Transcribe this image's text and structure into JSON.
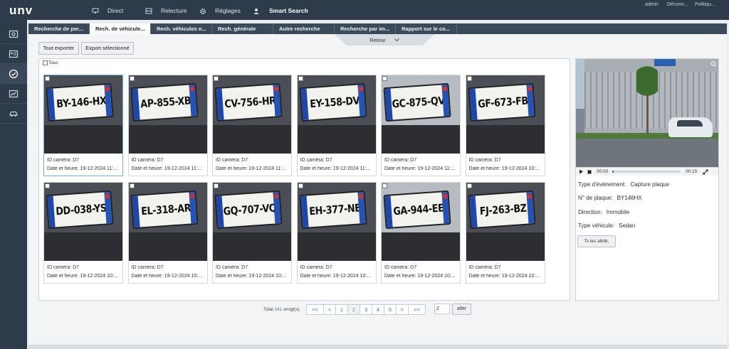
{
  "brand": {
    "logo": "unv"
  },
  "top_nav": {
    "items": [
      {
        "label": "Direct",
        "icon": "monitor-icon"
      },
      {
        "label": "Relecture",
        "icon": "film-icon"
      },
      {
        "label": "Réglages",
        "icon": "gear-icon"
      },
      {
        "label": "Smart Search",
        "icon": "person-search-icon",
        "active": true
      }
    ],
    "right_links": [
      "admin",
      "Déconn...",
      "Politiqu..."
    ]
  },
  "sidebar": {
    "items": [
      {
        "icon": "image-search-icon"
      },
      {
        "icon": "id-card-icon"
      },
      {
        "icon": "gauge-icon",
        "active": true
      },
      {
        "icon": "chart-icon"
      },
      {
        "icon": "car-icon"
      }
    ]
  },
  "tabs": [
    {
      "label": "Recherche de per..."
    },
    {
      "label": "Rech. de véhicule...",
      "active": true
    },
    {
      "label": "Rech. véhicules n..."
    },
    {
      "label": "Rech. générale"
    },
    {
      "label": "Autre recherche"
    },
    {
      "label": "Recherche par im..."
    },
    {
      "label": "Rapport sur le co..."
    }
  ],
  "retour": {
    "label": "Retour"
  },
  "toolbar": {
    "export_all": "Tout exporter",
    "export_selected": "Export sélectionné"
  },
  "select_all": {
    "label": "Tous"
  },
  "results": [
    {
      "plate": "BY-146-HX",
      "camera": "ID caméra: D7",
      "datetime": "Date et heure: 19-12-2024 11:...",
      "selected": true
    },
    {
      "plate": "AP-855-XB",
      "camera": "ID caméra: D7",
      "datetime": "Date et heure: 19-12-2024 11:..."
    },
    {
      "plate": "CV-756-HR",
      "camera": "ID caméra: D7",
      "datetime": "Date et heure: 19-12-2024 11:..."
    },
    {
      "plate": "EY-158-DV",
      "camera": "ID caméra: D7",
      "datetime": "Date et heure: 19-12-2024 11:..."
    },
    {
      "plate": "GC-875-QV",
      "camera": "ID caméra: D7",
      "datetime": "Date et heure: 19-12-2024 11:..."
    },
    {
      "plate": "GF-673-FB",
      "camera": "ID caméra: D7",
      "datetime": "Date et heure: 19-12-2024 10:..."
    },
    {
      "plate": "DD-038-YS",
      "camera": "ID caméra: D7",
      "datetime": "Date et heure: 19-12-2024 10:..."
    },
    {
      "plate": "EL-318-AR",
      "camera": "ID caméra: D7",
      "datetime": "Date et heure: 19-12-2024 10:..."
    },
    {
      "plate": "GQ-707-VQ",
      "camera": "ID caméra: D7",
      "datetime": "Date et heure: 19-12-2024 10:..."
    },
    {
      "plate": "EH-377-NE",
      "camera": "ID caméra: D7",
      "datetime": "Date et heure: 19-12-2024 10:..."
    },
    {
      "plate": "GA-944-EE",
      "camera": "ID caméra: D7",
      "datetime": "Date et heure: 19-12-2024 10:..."
    },
    {
      "plate": "FJ-263-BZ",
      "camera": "ID caméra: D7",
      "datetime": "Date et heure: 19-12-2024 10:..."
    }
  ],
  "pagination": {
    "total_prefix": "Total",
    "total_count": "241",
    "total_suffix": "enrgt(s)",
    "buttons": [
      "<<",
      "<",
      "1",
      "2",
      "3",
      "4",
      "5",
      ">",
      ">>"
    ],
    "current": "2",
    "goto_value": "2",
    "goto_label": "aller"
  },
  "player": {
    "start": "00:00",
    "end": "00:15",
    "progress": 0.02
  },
  "details": {
    "event_type_label": "Type d'événement:",
    "event_type_value": "Capture plaque",
    "plate_label": "N° de plaque:",
    "plate_value": "BY146HX",
    "direction_label": "Direction:",
    "direction_value": "Immobile",
    "vehicle_type_label": "Type véhicule:",
    "vehicle_type_value": "Sedan",
    "all_attributes_button": "Ts les attrib."
  },
  "colors": {
    "topbar": "#2e3b4a",
    "accent": "#2b7bc4",
    "plate_blue": "#1f47a8"
  }
}
